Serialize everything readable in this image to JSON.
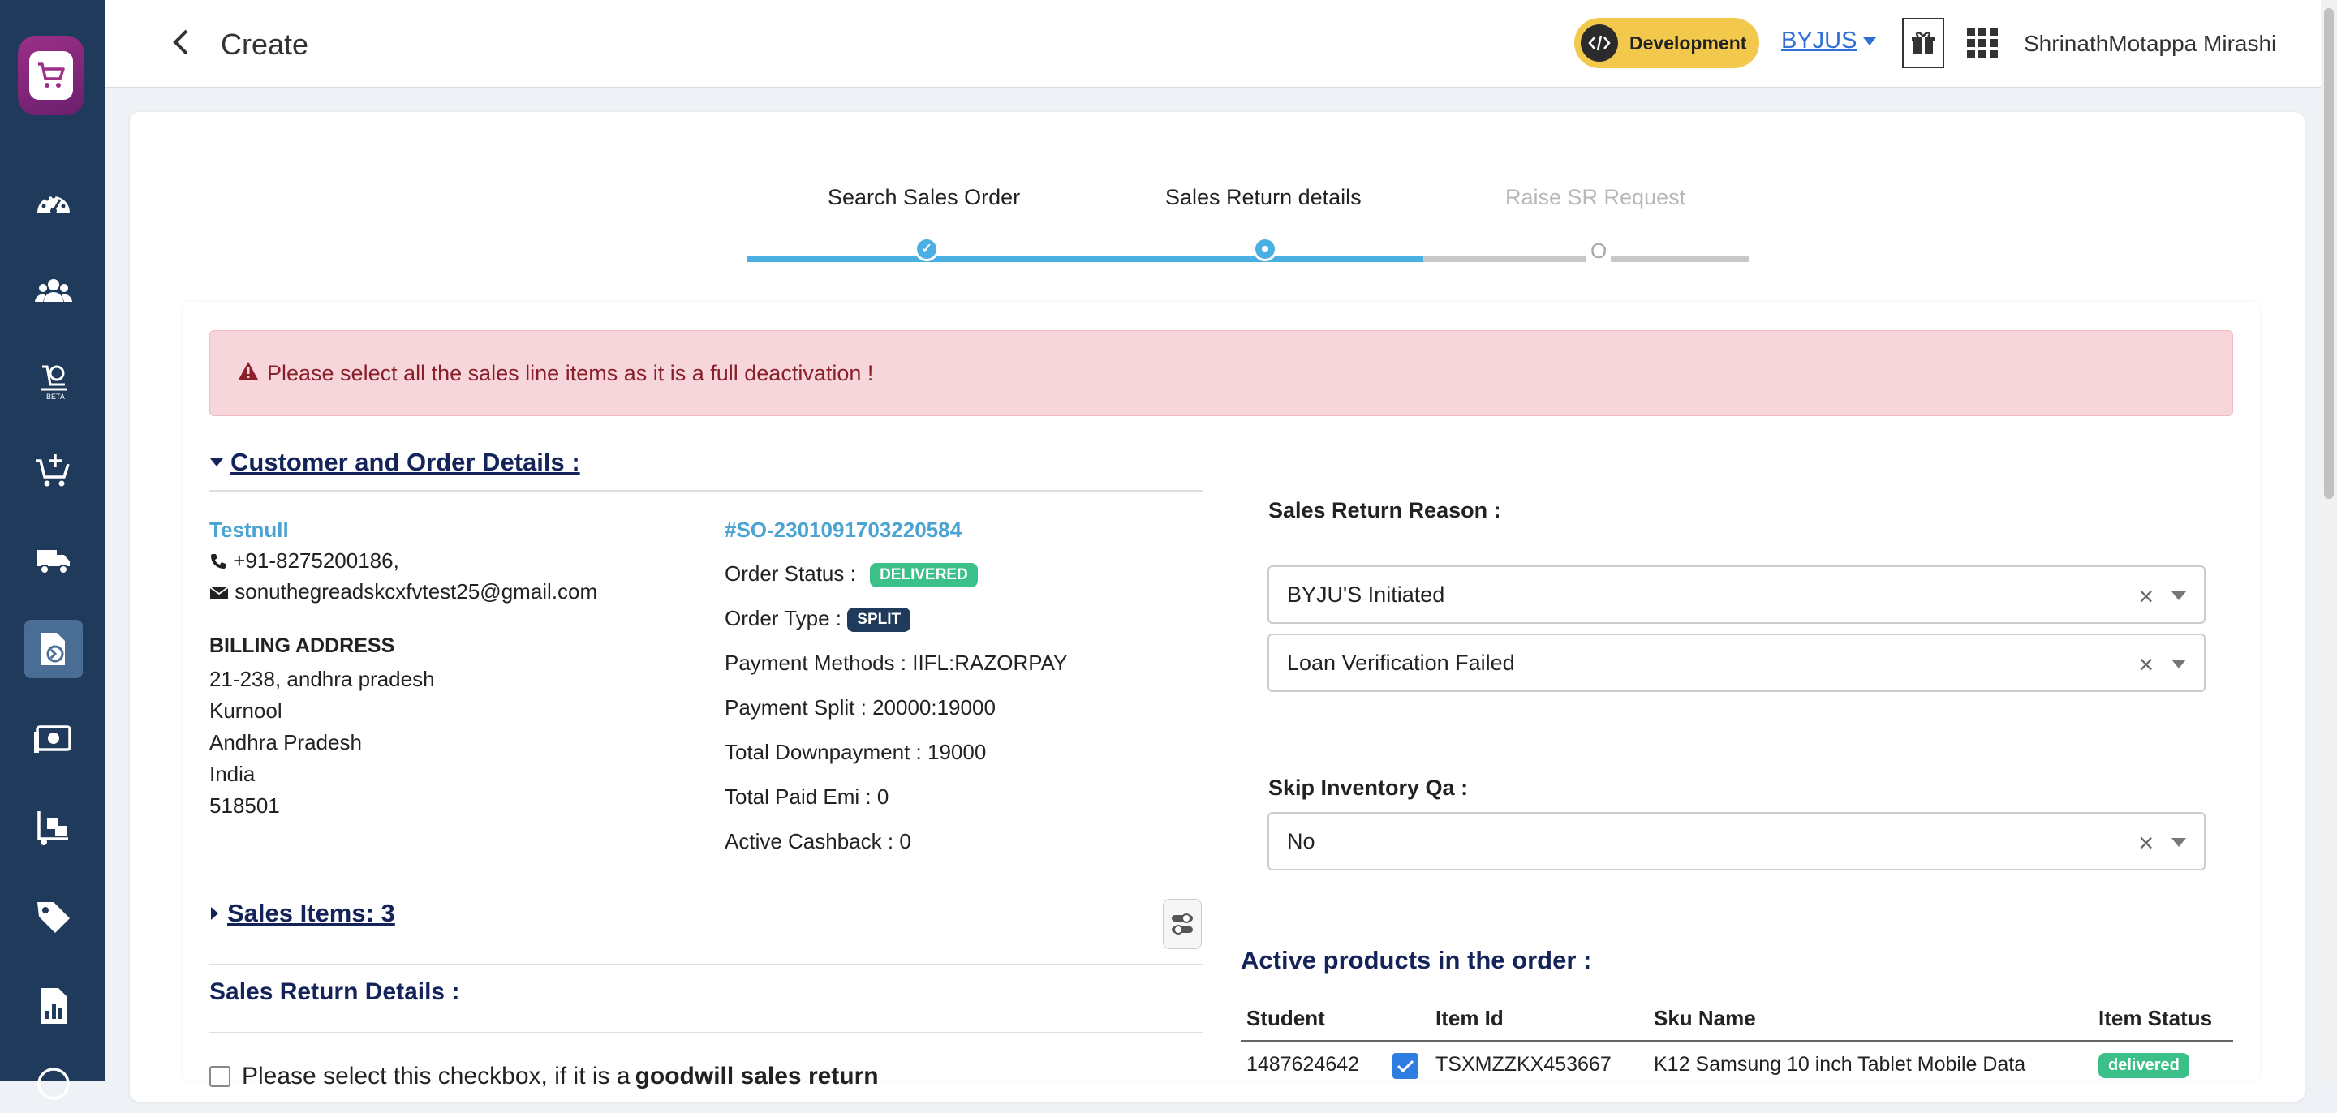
{
  "header": {
    "title": "Create",
    "environment": "Development",
    "organization": "BYJUS",
    "user_name": "ShrinathMotappa Mirashi"
  },
  "sidebar": {
    "items": [
      {
        "icon": "dashboard-icon"
      },
      {
        "icon": "users-icon"
      },
      {
        "icon": "beta-tool-icon"
      },
      {
        "icon": "cart-add-icon"
      },
      {
        "icon": "delivery-truck-icon"
      },
      {
        "icon": "sales-return-icon",
        "active": true
      },
      {
        "icon": "payments-icon"
      },
      {
        "icon": "inventory-icon"
      },
      {
        "icon": "tag-icon"
      },
      {
        "icon": "reports-icon"
      }
    ]
  },
  "stepper": {
    "steps": [
      {
        "label": "Search Sales Order",
        "state": "done",
        "mark": "✓"
      },
      {
        "label": "Sales Return details",
        "state": "current"
      },
      {
        "label": "Raise SR Request",
        "state": "pending",
        "mark": "O"
      }
    ]
  },
  "alert": {
    "message": "Please select all the sales line items as it is a full deactivation !"
  },
  "customer_section": {
    "title": "Customer and Order Details :",
    "customer": {
      "name": "Testnull",
      "phone": "+91-8275200186,",
      "email": "sonuthegreadskcxfvtest25@gmail.com"
    },
    "billing": {
      "title": "BILLING ADDRESS",
      "lines": [
        "21-238, andhra pradesh",
        "Kurnool",
        "Andhra Pradesh",
        "India",
        "518501"
      ]
    },
    "order": {
      "id": "#SO-2301091703220584",
      "status_label": "Order Status :",
      "status": "DELIVERED",
      "type_label": "Order Type :",
      "type": "SPLIT",
      "payment_methods": "Payment Methods : IIFL:RAZORPAY",
      "payment_split": "Payment Split : 20000:19000",
      "total_downpayment": "Total Downpayment : 19000",
      "total_paid_emi": "Total Paid Emi : 0",
      "active_cashback": "Active Cashback : 0"
    }
  },
  "sales_items": {
    "title": "Sales Items: 3"
  },
  "sales_return_details": {
    "title": "Sales Return Details :",
    "goodwill_prefix": "Please select this checkbox, if it is a ",
    "goodwill_bold": "goodwill sales return"
  },
  "form": {
    "reason_label": "Sales Return Reason :",
    "reason_primary": "BYJU'S Initiated",
    "reason_secondary": "Loan Verification Failed",
    "skip_qa_label": "Skip Inventory Qa :",
    "skip_qa_value": "No"
  },
  "products": {
    "title": "Active products in the order :",
    "columns": [
      "Student",
      "Item Id",
      "Sku Name",
      "Item Status"
    ],
    "rows": [
      {
        "student": "1487624642",
        "checked": true,
        "item_id": "TSXMZZKX453667",
        "sku_name": "K12 Samsung 10 inch Tablet Mobile Data",
        "status": "delivered"
      }
    ]
  },
  "colors": {
    "sidebar": "#1f3a5a",
    "accent": "#4ab0e4",
    "delivered_badge": "#3cc08a",
    "split_badge": "#1f3a5a",
    "alert_bg": "#f6d6da",
    "env_badge": "#f2c94c"
  }
}
